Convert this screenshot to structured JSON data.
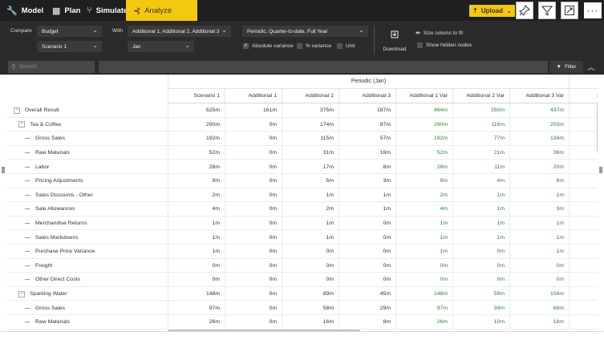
{
  "nav": {
    "items": [
      {
        "label": "Model",
        "icon": "wrench-icon",
        "glyph": "🔧"
      },
      {
        "label": "Plan",
        "icon": "grid-icon",
        "glyph": "▦"
      },
      {
        "label": "Simulate",
        "icon": "branch-icon",
        "glyph": "⑂"
      },
      {
        "label": "Analyze",
        "icon": "chart-icon",
        "glyph": "⊰"
      }
    ],
    "active": "Analyze",
    "upload_label": "Upload",
    "upload_glyph": "⇡",
    "tools": {
      "pin": "☐",
      "filter": "⚲",
      "expand": "⤢",
      "more": "···"
    }
  },
  "toolbar": {
    "compare_label": "Compare",
    "compare_value": "Budget",
    "compare_scenario": "Scenario 1",
    "with_label": "With",
    "with_value": "Additional 1, Additional 2, Additional 3",
    "with_period": "Jan",
    "period_value": "Periodic, Quarter-to-date, Full Year",
    "absolute_variance": "Absolute variance",
    "percent_variance": "% variance",
    "unit": "Unit",
    "download_label": "Download",
    "size_columns": "Size colums to fit",
    "show_hidden": "Show hidden nodes"
  },
  "search": {
    "placeholder": "Search",
    "filter_label": "Filter"
  },
  "grid": {
    "group_header": "Periodic (Jan)",
    "columns": [
      "Scenario 1",
      "Additional 1",
      "Additional 2",
      "Additional 3",
      "Additional 1 Var",
      "Additional 2 Var",
      "Additional 3 Var",
      "Sce"
    ],
    "rows": [
      {
        "label": "Overall Result",
        "level": 0,
        "values": [
          "625m",
          "161m",
          "375m",
          "187m",
          "464m",
          "250m",
          "437m"
        ]
      },
      {
        "label": "Tea & Coffee",
        "level": 1,
        "values": [
          "290m",
          "0m",
          "174m",
          "87m",
          "290m",
          "116m",
          "203m"
        ]
      },
      {
        "label": "Gross Sales",
        "level": 2,
        "values": [
          "192m",
          "0m",
          "115m",
          "57m",
          "192m",
          "77m",
          "134m"
        ]
      },
      {
        "label": "Raw Materials",
        "level": 2,
        "values": [
          "52m",
          "0m",
          "31m",
          "16m",
          "52m",
          "21m",
          "36m"
        ]
      },
      {
        "label": "Labor",
        "level": 2,
        "values": [
          "28m",
          "0m",
          "17m",
          "8m",
          "28m",
          "11m",
          "20m"
        ]
      },
      {
        "label": "Pricing Adjustments",
        "level": 2,
        "values": [
          "9m",
          "0m",
          "5m",
          "3m",
          "9m",
          "4m",
          "6m"
        ]
      },
      {
        "label": "Sales Discounts - Other",
        "level": 2,
        "values": [
          "2m",
          "0m",
          "1m",
          "1m",
          "2m",
          "1m",
          "1m"
        ]
      },
      {
        "label": "Sale Allowances",
        "level": 2,
        "values": [
          "4m",
          "0m",
          "2m",
          "1m",
          "4m",
          "1m",
          "3m"
        ]
      },
      {
        "label": "Merchandise Returns",
        "level": 2,
        "values": [
          "1m",
          "0m",
          "1m",
          "0m",
          "1m",
          "1m",
          "1m"
        ]
      },
      {
        "label": "Sales Markdowns",
        "level": 2,
        "values": [
          "1m",
          "0m",
          "1m",
          "0m",
          "1m",
          "1m",
          "1m"
        ]
      },
      {
        "label": "Purchase Price Variance",
        "level": 2,
        "values": [
          "1m",
          "0m",
          "0m",
          "0m",
          "1m",
          "0m",
          "1m"
        ]
      },
      {
        "label": "Freight",
        "level": 2,
        "values": [
          "0m",
          "0m",
          "0m",
          "0m",
          "0m",
          "0m",
          "0m"
        ]
      },
      {
        "label": "Other Direct Costs",
        "level": 2,
        "values": [
          "0m",
          "0m",
          "0m",
          "0m",
          "0m",
          "0m",
          "0m"
        ]
      },
      {
        "label": "Sparking Water",
        "level": 1,
        "values": [
          "148m",
          "0m",
          "89m",
          "45m",
          "148m",
          "59m",
          "104m"
        ]
      },
      {
        "label": "Gross Sales",
        "level": 2,
        "values": [
          "97m",
          "0m",
          "58m",
          "29m",
          "97m",
          "39m",
          "68m"
        ]
      },
      {
        "label": "Raw Materials",
        "level": 2,
        "values": [
          "26m",
          "0m",
          "16m",
          "8m",
          "26m",
          "10m",
          "18m"
        ]
      }
    ]
  },
  "colors": {
    "accent": "#f2c811",
    "variance": "#2e7d32",
    "dark_bg": "#2b2b2b"
  }
}
